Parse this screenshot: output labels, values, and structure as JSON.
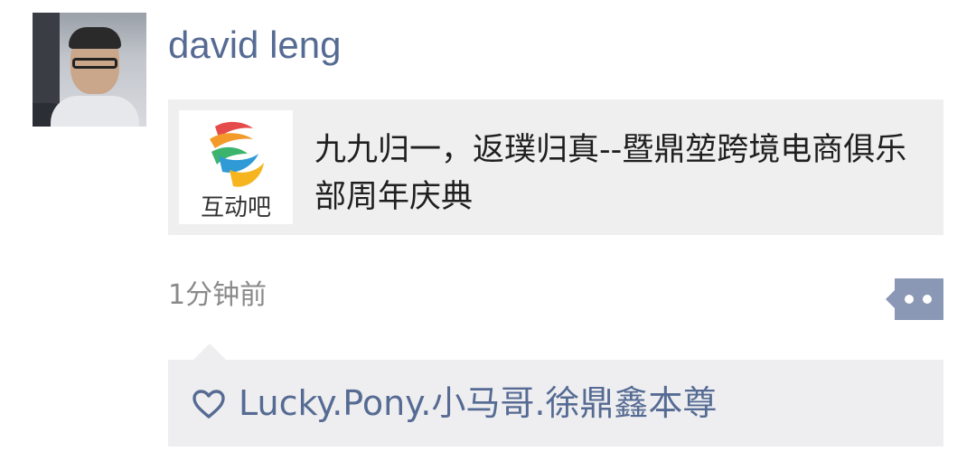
{
  "post": {
    "author": "david leng",
    "link_card": {
      "thumbnail_caption": "互动吧",
      "title": "九九归一，返璞归真--暨鼎堃跨境电商俱乐部周年庆典"
    },
    "timestamp": "1分钟前"
  },
  "likes": {
    "icon": "heart-outline-icon",
    "names": "Lucky.Pony.小马哥.徐鼎鑫本尊"
  },
  "colors": {
    "name_link": "#566b93",
    "card_bg": "#efeff0",
    "more_button": "#8a98b6",
    "timestamp": "#8a8a8a"
  }
}
